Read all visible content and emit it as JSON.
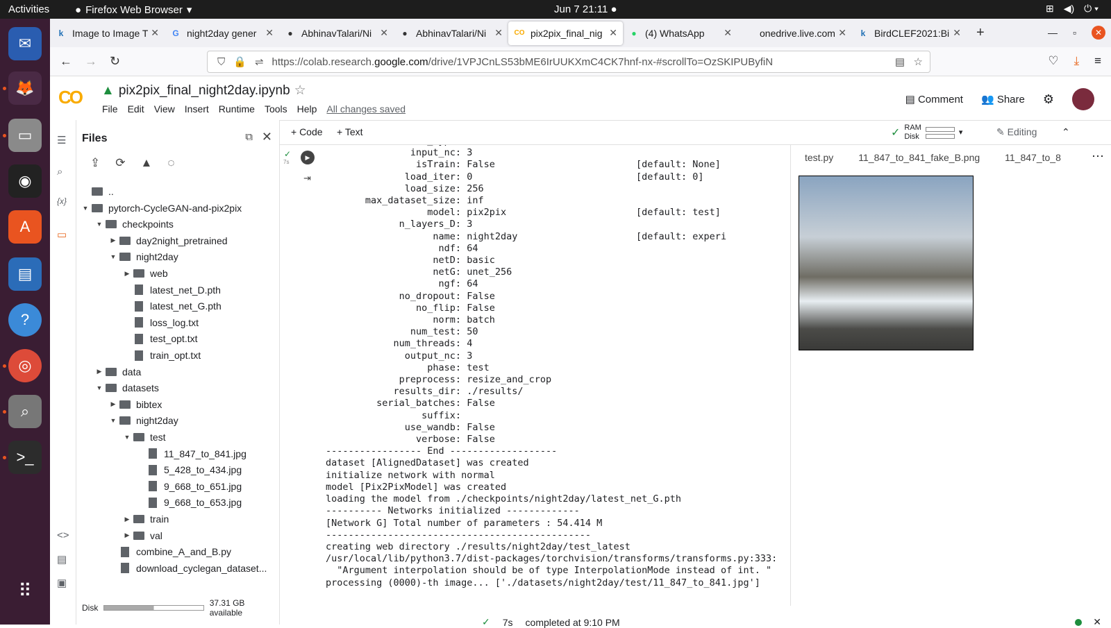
{
  "system": {
    "activities": "Activities",
    "app": "Firefox Web Browser",
    "clock": "Jun 7  21:11"
  },
  "tabs": [
    {
      "label": "Image to Image T",
      "icon": "k"
    },
    {
      "label": "night2day gener",
      "icon": "G"
    },
    {
      "label": "AbhinavTalari/Ni",
      "icon": "●"
    },
    {
      "label": "AbhinavTalari/Ni",
      "icon": "●"
    },
    {
      "label": "pix2pix_final_nig",
      "icon": "CO"
    },
    {
      "label": "(4) WhatsApp",
      "icon": "●"
    },
    {
      "label": "onedrive.live.com/?c",
      "icon": ""
    },
    {
      "label": "BirdCLEF2021:Bi",
      "icon": "k"
    }
  ],
  "url": {
    "prefix": "https://colab.research.",
    "domain": "google.com",
    "rest": "/drive/1VPJCnLS53bME6IrUUKXmC4CK7hnf-nx-#scrollTo=OzSKIPUByfiN"
  },
  "colab": {
    "logo": "CO",
    "title": "pix2pix_final_night2day.ipynb",
    "menu": [
      "File",
      "Edit",
      "View",
      "Insert",
      "Runtime",
      "Tools",
      "Help"
    ],
    "saved": "All changes saved",
    "comment": "Comment",
    "share": "Share"
  },
  "toolbar": {
    "code": "+ Code",
    "text": "+ Text",
    "ram": "RAM",
    "disk": "Disk",
    "editing": "Editing"
  },
  "files": {
    "title": "Files",
    "disk_label": "Disk",
    "disk_avail": "37.31 GB available",
    "tree": [
      {
        "label": "..",
        "depth": 0,
        "kind": "up"
      },
      {
        "label": "pytorch-CycleGAN-and-pix2pix",
        "depth": 0,
        "kind": "folder",
        "open": true
      },
      {
        "label": "checkpoints",
        "depth": 1,
        "kind": "folder",
        "open": true
      },
      {
        "label": "day2night_pretrained",
        "depth": 2,
        "kind": "folder",
        "open": false
      },
      {
        "label": "night2day",
        "depth": 2,
        "kind": "folder",
        "open": true
      },
      {
        "label": "web",
        "depth": 3,
        "kind": "folder",
        "open": false
      },
      {
        "label": "latest_net_D.pth",
        "depth": 3,
        "kind": "file"
      },
      {
        "label": "latest_net_G.pth",
        "depth": 3,
        "kind": "file"
      },
      {
        "label": "loss_log.txt",
        "depth": 3,
        "kind": "file"
      },
      {
        "label": "test_opt.txt",
        "depth": 3,
        "kind": "file"
      },
      {
        "label": "train_opt.txt",
        "depth": 3,
        "kind": "file"
      },
      {
        "label": "data",
        "depth": 1,
        "kind": "folder",
        "open": false
      },
      {
        "label": "datasets",
        "depth": 1,
        "kind": "folder",
        "open": true
      },
      {
        "label": "bibtex",
        "depth": 2,
        "kind": "folder",
        "open": false
      },
      {
        "label": "night2day",
        "depth": 2,
        "kind": "folder",
        "open": true
      },
      {
        "label": "test",
        "depth": 3,
        "kind": "folder",
        "open": true
      },
      {
        "label": "11_847_to_841.jpg",
        "depth": 4,
        "kind": "file"
      },
      {
        "label": "5_428_to_434.jpg",
        "depth": 4,
        "kind": "file"
      },
      {
        "label": "9_668_to_651.jpg",
        "depth": 4,
        "kind": "file"
      },
      {
        "label": "9_668_to_653.jpg",
        "depth": 4,
        "kind": "file"
      },
      {
        "label": "train",
        "depth": 3,
        "kind": "folder",
        "open": false
      },
      {
        "label": "val",
        "depth": 3,
        "kind": "folder",
        "open": false
      },
      {
        "label": "combine_A_and_B.py",
        "depth": 2,
        "kind": "file"
      },
      {
        "label": "download_cyclegan_dataset...",
        "depth": 2,
        "kind": "file"
      }
    ]
  },
  "cell": {
    "time": "7s",
    "output": "              init_type: normal\n               input_nc: 3\n                isTrain: False                         [default: None]\n              load_iter: 0                             [default: 0]\n              load_size: 256\n       max_dataset_size: inf\n                  model: pix2pix                       [default: test]\n             n_layers_D: 3\n                   name: night2day                     [default: experi\n                    ndf: 64\n                   netD: basic\n                   netG: unet_256\n                    ngf: 64\n             no_dropout: False\n                no_flip: False\n                   norm: batch\n               num_test: 50\n            num_threads: 4\n              output_nc: 3\n                  phase: test\n             preprocess: resize_and_crop\n            results_dir: ./results/\n         serial_batches: False\n                 suffix: \n              use_wandb: False\n                verbose: False\n----------------- End -------------------\ndataset [AlignedDataset] was created\ninitialize network with normal\nmodel [Pix2PixModel] was created\nloading the model from ./checkpoints/night2day/latest_net_G.pth\n---------- Networks initialized -------------\n[Network G] Total number of parameters : 54.414 M\n-----------------------------------------------\ncreating web directory ./results/night2day/test_latest\n/usr/local/lib/python3.7/dist-packages/torchvision/transforms/transforms.py:333:\n  \"Argument interpolation should be of type InterpolationMode instead of int. \"\nprocessing (0000)-th image... ['./datasets/night2day/test/11_847_to_841.jpg']"
  },
  "preview": {
    "tabs": [
      "test.py",
      "11_847_to_841_fake_B.png",
      "11_847_to_8"
    ]
  },
  "status": {
    "time": "7s",
    "text": "completed at 9:10 PM"
  }
}
